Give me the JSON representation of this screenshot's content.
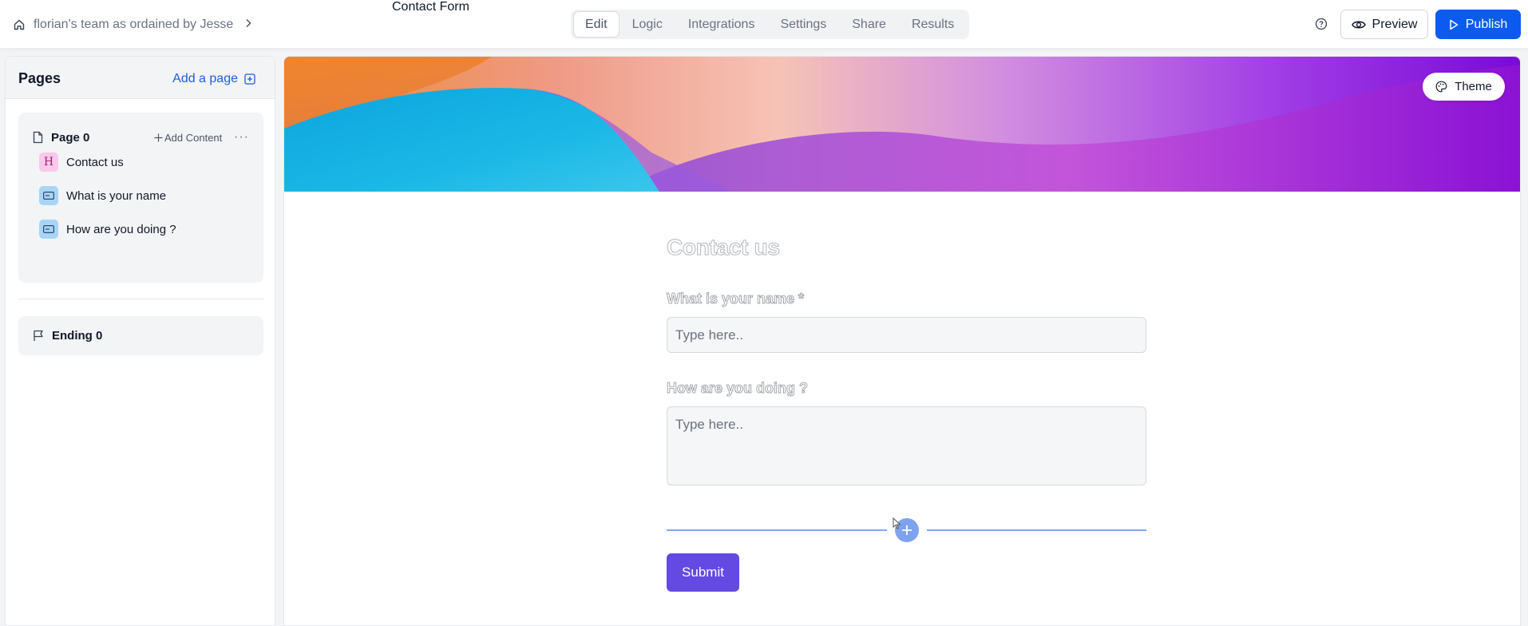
{
  "header": {
    "team_name": "florian's team as ordained by Jesse",
    "form_name": "Contact Form",
    "tabs": [
      {
        "label": "Edit",
        "active": true
      },
      {
        "label": "Logic",
        "active": false
      },
      {
        "label": "Integrations",
        "active": false
      },
      {
        "label": "Settings",
        "active": false
      },
      {
        "label": "Share",
        "active": false
      },
      {
        "label": "Results",
        "active": false
      }
    ],
    "preview_label": "Preview",
    "publish_label": "Publish"
  },
  "sidebar": {
    "title": "Pages",
    "add_page_label": "Add a page",
    "page": {
      "label": "Page 0",
      "add_content_label": "Add Content",
      "more_glyph": "···",
      "items": [
        {
          "label": "Contact us",
          "kind": "heading",
          "icon_glyph": "H"
        },
        {
          "label": "What is your name",
          "kind": "text-input"
        },
        {
          "label": "How are you doing ?",
          "kind": "text-input"
        }
      ]
    },
    "ending": {
      "label": "Ending 0"
    }
  },
  "canvas": {
    "theme_label": "Theme",
    "form": {
      "title": "Contact us",
      "questions": [
        {
          "label": "What is your name *",
          "placeholder": "Type here.."
        },
        {
          "label": "How are you doing ?",
          "placeholder": "Type here.."
        }
      ],
      "submit_label": "Submit"
    }
  },
  "colors": {
    "primary_button": "#0b5bf0",
    "submit_button": "#6549e3",
    "add_block": "#7fa2ef",
    "link": "#1d5fd8"
  },
  "icons": {
    "home": "home-icon",
    "chevron": "chevron-right-icon",
    "help": "help-circle-icon",
    "preview": "eye-icon",
    "publish": "play-icon",
    "add_page": "plus-square-icon",
    "page": "file-icon",
    "ending": "flag-icon",
    "theme": "palette-icon"
  }
}
